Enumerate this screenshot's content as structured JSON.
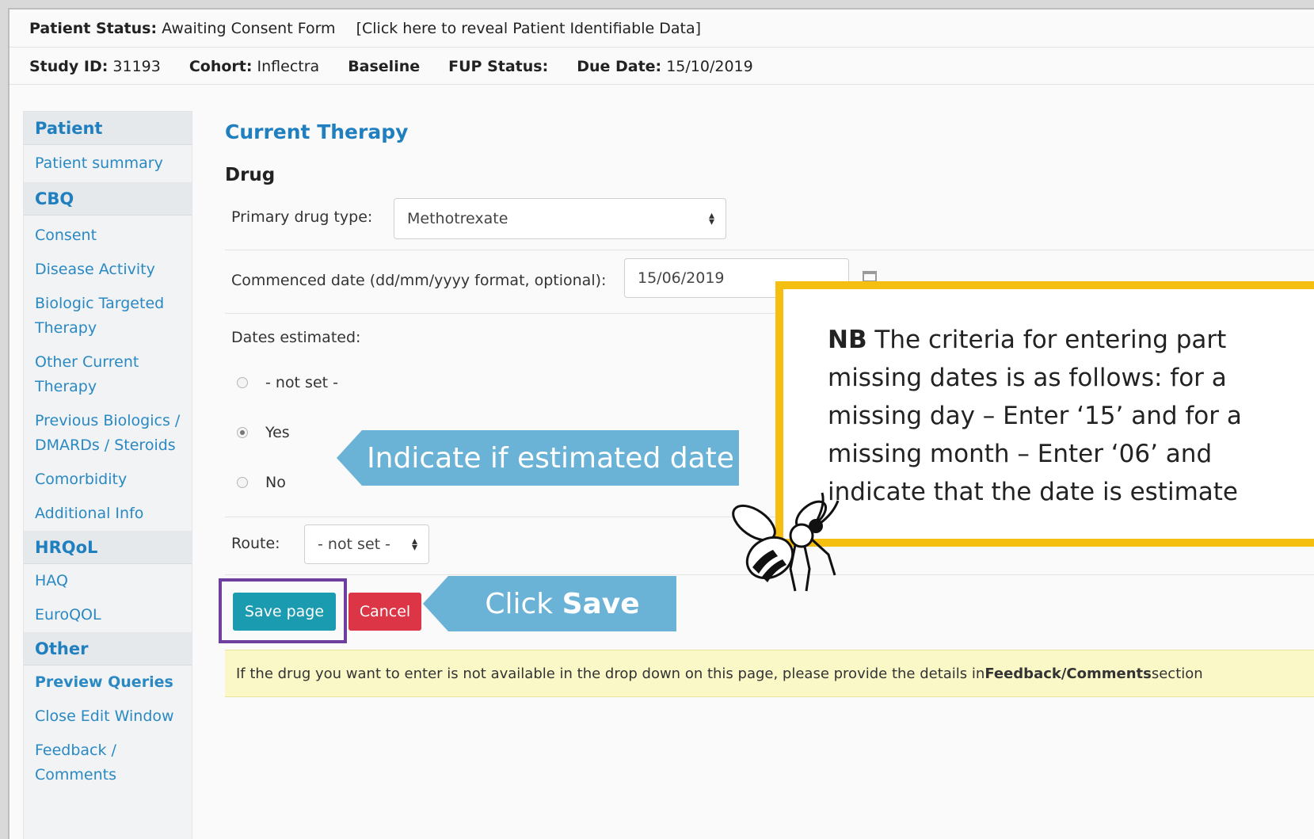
{
  "status_bar": {
    "patient_status_label": "Patient Status:",
    "patient_status_value": "Awaiting Consent Form",
    "reveal_link": "[Click here to reveal Patient Identifiable Data]"
  },
  "info_bar": {
    "study_id_label": "Study ID:",
    "study_id_value": "31193",
    "cohort_label": "Cohort:",
    "cohort_value": "Inflectra",
    "baseline_label": "Baseline",
    "fup_status_label": "FUP Status:",
    "due_date_label": "Due Date:",
    "due_date_value": "15/10/2019"
  },
  "sidebar": {
    "sections": [
      {
        "heading": "Patient",
        "items": [
          "Patient summary"
        ]
      },
      {
        "heading": "CBQ",
        "items": [
          "Consent",
          "Disease Activity",
          "Biologic Targeted Therapy",
          "Other Current Therapy",
          "Previous Biologics / DMARDs / Steroids",
          "Comorbidity",
          "Additional Info"
        ]
      },
      {
        "heading": "HRQoL",
        "items": [
          "HAQ",
          "EuroQOL"
        ]
      },
      {
        "heading": "Other",
        "items": [
          "Preview Queries",
          "Close Edit Window",
          "Feedback / Comments"
        ]
      }
    ]
  },
  "main": {
    "page_title": "Current Therapy",
    "section_title": "Drug",
    "primary_drug_label": "Primary drug type:",
    "primary_drug_value": "Methotrexate",
    "commenced_label": "Commenced date (dd/mm/yyyy format, optional):",
    "commenced_value": "15/06/2019",
    "dates_estimated_label": "Dates estimated:",
    "radio_options": [
      "- not set -",
      "Yes",
      "No"
    ],
    "radio_selected": "Yes",
    "route_label": "Route:",
    "route_value": "- not set -",
    "save_label": "Save page",
    "cancel_label": "Cancel",
    "notice_prefix": "If the drug you want to enter is not available in the drop down on this page, please provide the details in ",
    "notice_bold": "Feedback/Comments",
    "notice_suffix": " section"
  },
  "annotations": {
    "estimated_callout": "Indicate if estimated date",
    "save_callout_prefix": "Click ",
    "save_callout_bold": "Save",
    "nb_bold": "NB",
    "nb_lines": [
      " The criteria for entering part",
      "missing dates is as follows: for a",
      "missing day – Enter ‘15’ and for a",
      "missing month – Enter ‘06’ and",
      "indicate that the date is estimate"
    ]
  },
  "colors": {
    "accent_blue": "#1f7fbf",
    "save_button": "#1b9bb0",
    "cancel_button": "#dc3545",
    "callout": "#6ab2d6",
    "nb_border": "#f5bf12",
    "highlight": "#6f3fa0"
  }
}
